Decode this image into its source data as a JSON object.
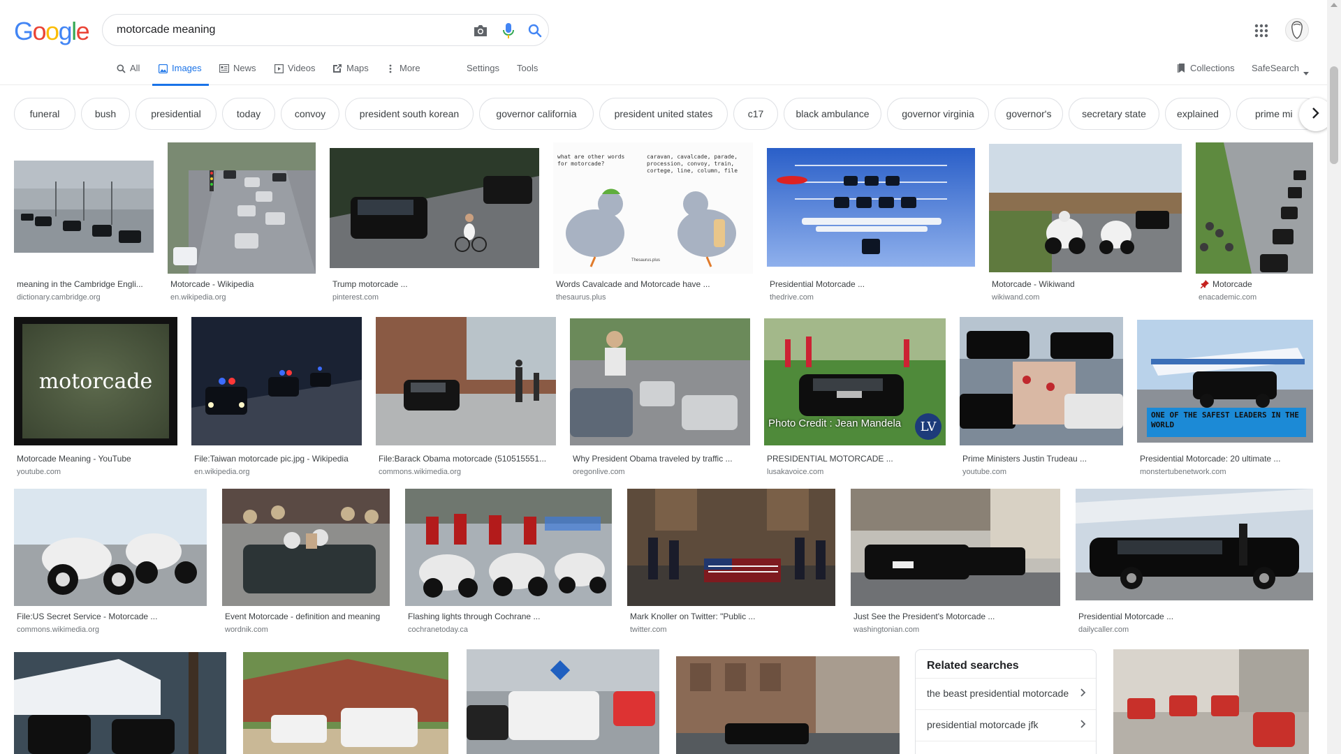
{
  "logo": {
    "letters": [
      "G",
      "o",
      "o",
      "g",
      "l",
      "e"
    ],
    "colors": [
      "#4285f4",
      "#ea4335",
      "#fbbc05",
      "#4285f4",
      "#34a853",
      "#ea4335"
    ]
  },
  "search": {
    "query": "motorcade meaning"
  },
  "tabs": [
    {
      "label": "All",
      "icon": "search-icon"
    },
    {
      "label": "Images",
      "icon": "image-icon",
      "active": true
    },
    {
      "label": "News",
      "icon": "news-icon"
    },
    {
      "label": "Videos",
      "icon": "video-icon"
    },
    {
      "label": "Maps",
      "icon": "map-icon"
    },
    {
      "label": "More",
      "icon": "more-vertical-icon"
    }
  ],
  "tools": {
    "settings": "Settings",
    "tools": "Tools",
    "collections": "Collections",
    "safesearch": "SafeSearch"
  },
  "chips": [
    "funeral",
    "bush",
    "presidential",
    "today",
    "convoy",
    "president south korean",
    "governor california",
    "president united states",
    "c17",
    "black ambulance",
    "governor virginia",
    "governor's",
    "secretary state",
    "explained",
    "prime mi"
  ],
  "results": [
    {
      "caption": "meaning in the Cambridge Engli...",
      "source": "dictionary.cambridge.org"
    },
    {
      "caption": "Motorcade - Wikipedia",
      "source": "en.wikipedia.org"
    },
    {
      "caption": "Trump motorcade ...",
      "source": "pinterest.com"
    },
    {
      "caption": "Words Cavalcade and Motorcade have ...",
      "source": "thesaurus.plus"
    },
    {
      "caption": "Presidential Motorcade ...",
      "source": "thedrive.com"
    },
    {
      "caption": "Motorcade - Wikiwand",
      "source": "wikiwand.com"
    },
    {
      "caption": "Motorcade",
      "source": "enacademic.com"
    },
    {
      "caption": "Motorcade Meaning - YouTube",
      "source": "youtube.com"
    },
    {
      "caption": "File:Taiwan motorcade pic.jpg - Wikipedia",
      "source": "en.wikipedia.org"
    },
    {
      "caption": "File:Barack Obama motorcade (510515551...",
      "source": "commons.wikimedia.org"
    },
    {
      "caption": "Why President Obama traveled by traffic ...",
      "source": "oregonlive.com"
    },
    {
      "caption": "PRESIDENTIAL MOTORCADE ...",
      "source": "lusakavoice.com"
    },
    {
      "caption": "Prime Ministers Justin Trudeau ...",
      "source": "youtube.com"
    },
    {
      "caption": "Presidential Motorcade: 20 ultimate ...",
      "source": "monstertubenetwork.com"
    },
    {
      "caption": "File:US Secret Service - Motorcade ...",
      "source": "commons.wikimedia.org"
    },
    {
      "caption": "Event Motorcade - definition and meaning",
      "source": "wordnik.com"
    },
    {
      "caption": "Flashing lights through Cochrane ...",
      "source": "cochranetoday.ca"
    },
    {
      "caption": "Mark Knoller on Twitter: \"Public ...",
      "source": "twitter.com"
    },
    {
      "caption": "Just See the President's Motorcade ...",
      "source": "washingtonian.com"
    },
    {
      "caption": "Presidential Motorcade ...",
      "source": "dailycaller.com"
    }
  ],
  "image_text": {
    "motorcade_title": "motorcade",
    "pigeon_question": "what are other words for motorcade?",
    "pigeon_answer": "caravan, cavalcade, parade, procession, convoy, train, cortege, line, column, file",
    "thesaurus_brand": "Thesaurus.plus",
    "photo_credit": "Photo Credit : Jean Mandela",
    "lv_logo": "LV",
    "safest_banner": "ONE OF THE SAFEST LEADERS IN THE WORLD"
  },
  "related": {
    "title": "Related searches",
    "items": [
      "the beast presidential motorcade",
      "presidential motorcade jfk"
    ]
  }
}
